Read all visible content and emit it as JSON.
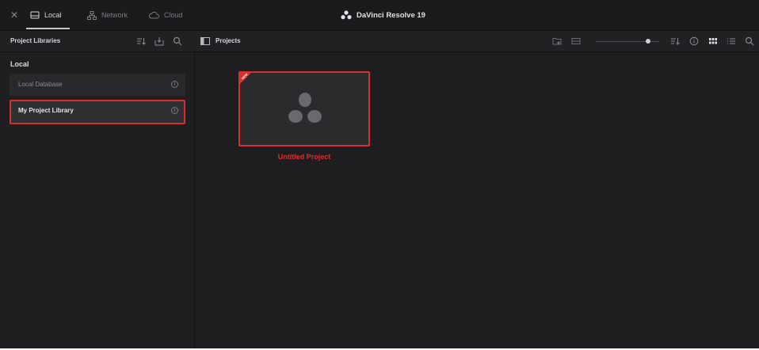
{
  "window": {
    "app_title": "DaVinci Resolve 19"
  },
  "tabs": [
    {
      "label": "Local",
      "icon": "drive-icon",
      "active": true
    },
    {
      "label": "Network",
      "icon": "network-icon",
      "active": false
    },
    {
      "label": "Cloud",
      "icon": "cloud-icon",
      "active": false
    }
  ],
  "sidebar": {
    "title": "Project Libraries",
    "section": "Local",
    "libraries": [
      {
        "label": "Local Database",
        "selected": false
      },
      {
        "label": "My Project Library",
        "selected": true
      }
    ]
  },
  "main": {
    "title": "Projects",
    "projects": [
      {
        "name": "Untitled Project",
        "badge": "NEW"
      }
    ]
  },
  "colors": {
    "accent": "#d8302f",
    "background": "#1e1e20",
    "panel": "#29292c"
  }
}
